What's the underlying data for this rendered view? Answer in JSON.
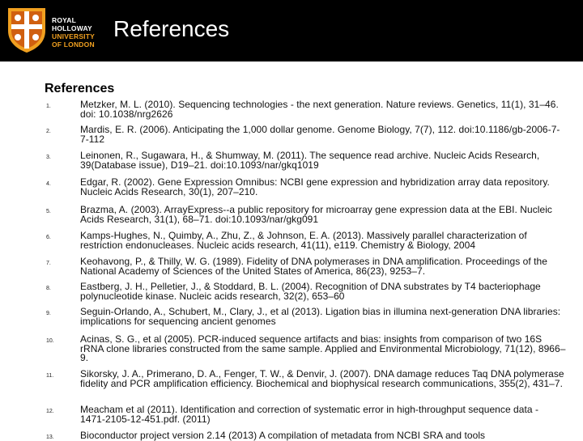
{
  "header": {
    "logo_lines": [
      "ROYAL",
      "HOLLOWAY",
      "UNIVERSITY",
      "OF LONDON"
    ],
    "title": "References",
    "bg_color": "#000000",
    "accent_color": "#f0a020"
  },
  "section": {
    "title": "References"
  },
  "references": [
    {
      "num": "1.",
      "text": "Metzker, M. L. (2010). Sequencing technologies - the next generation. Nature reviews. Genetics, 11(1), 31–46. doi: 10.1038/nrg2626"
    },
    {
      "num": "2.",
      "text": "Mardis, E. R. (2006). Anticipating the 1,000 dollar genome. Genome Biology, 7(7), 112. doi:10.1186/gb-2006-7-7-112"
    },
    {
      "num": "3.",
      "text": "Leinonen, R., Sugawara, H., & Shumway, M. (2011). The sequence read archive. Nucleic Acids Research, 39(Database issue), D19–21. doi:10.1093/nar/gkq1019"
    },
    {
      "num": "4.",
      "text": "Edgar, R. (2002). Gene Expression Omnibus: NCBI gene expression and hybridization array data repository. Nucleic Acids Research, 30(1), 207–210."
    },
    {
      "num": "5.",
      "text": "Brazma, A. (2003). ArrayExpress--a public repository for microarray gene expression data at the EBI. Nucleic Acids Research, 31(1), 68–71. doi:10.1093/nar/gkg091"
    },
    {
      "num": "6.",
      "text": "Kamps-Hughes, N., Quimby, A., Zhu, Z., & Johnson, E. A. (2013). Massively parallel characterization of restriction endonucleases. Nucleic acids research, 41(11), e119. Chemistry & Biology, 2004"
    },
    {
      "num": "7.",
      "text": "Keohavong, P., & Thilly, W. G. (1989). Fidelity of DNA polymerases in DNA amplification. Proceedings of the National Academy of Sciences of the United States of America, 86(23), 9253–7."
    },
    {
      "num": "8.",
      "text": "Eastberg, J. H., Pelletier, J., & Stoddard, B. L. (2004). Recognition of DNA substrates by T4 bacteriophage polynucleotide kinase. Nucleic acids research, 32(2), 653–60"
    },
    {
      "num": "9.",
      "text": "Seguin-Orlando, A., Schubert, M., Clary, J., et al (2013). Ligation bias in illumina next-generation DNA libraries: implications for sequencing ancient genomes"
    },
    {
      "num": "10.",
      "text": "Acinas, S. G., et al (2005). PCR-induced sequence artifacts and bias: insights from comparison of two 16S rRNA clone libraries constructed from the same sample. Applied and Environmental Microbiology, 71(12), 8966–9."
    },
    {
      "num": "11.",
      "text": "Sikorsky, J. A., Primerano, D. A., Fenger, T. W., & Denvir, J. (2007). DNA damage reduces Taq DNA polymerase fidelity and PCR amplification efficiency. Biochemical and biophysical research communications, 355(2), 431–7."
    },
    {
      "num": "12.",
      "text": "Meacham et al (2011). Identification and correction of systematic error in high-throughput sequence data - 1471-2105-12-451.pdf. (2011)"
    },
    {
      "num": "13.",
      "text": "Bioconductor project version 2.14 (2013) A compilation of metadata from NCBI SRA and tools"
    }
  ]
}
